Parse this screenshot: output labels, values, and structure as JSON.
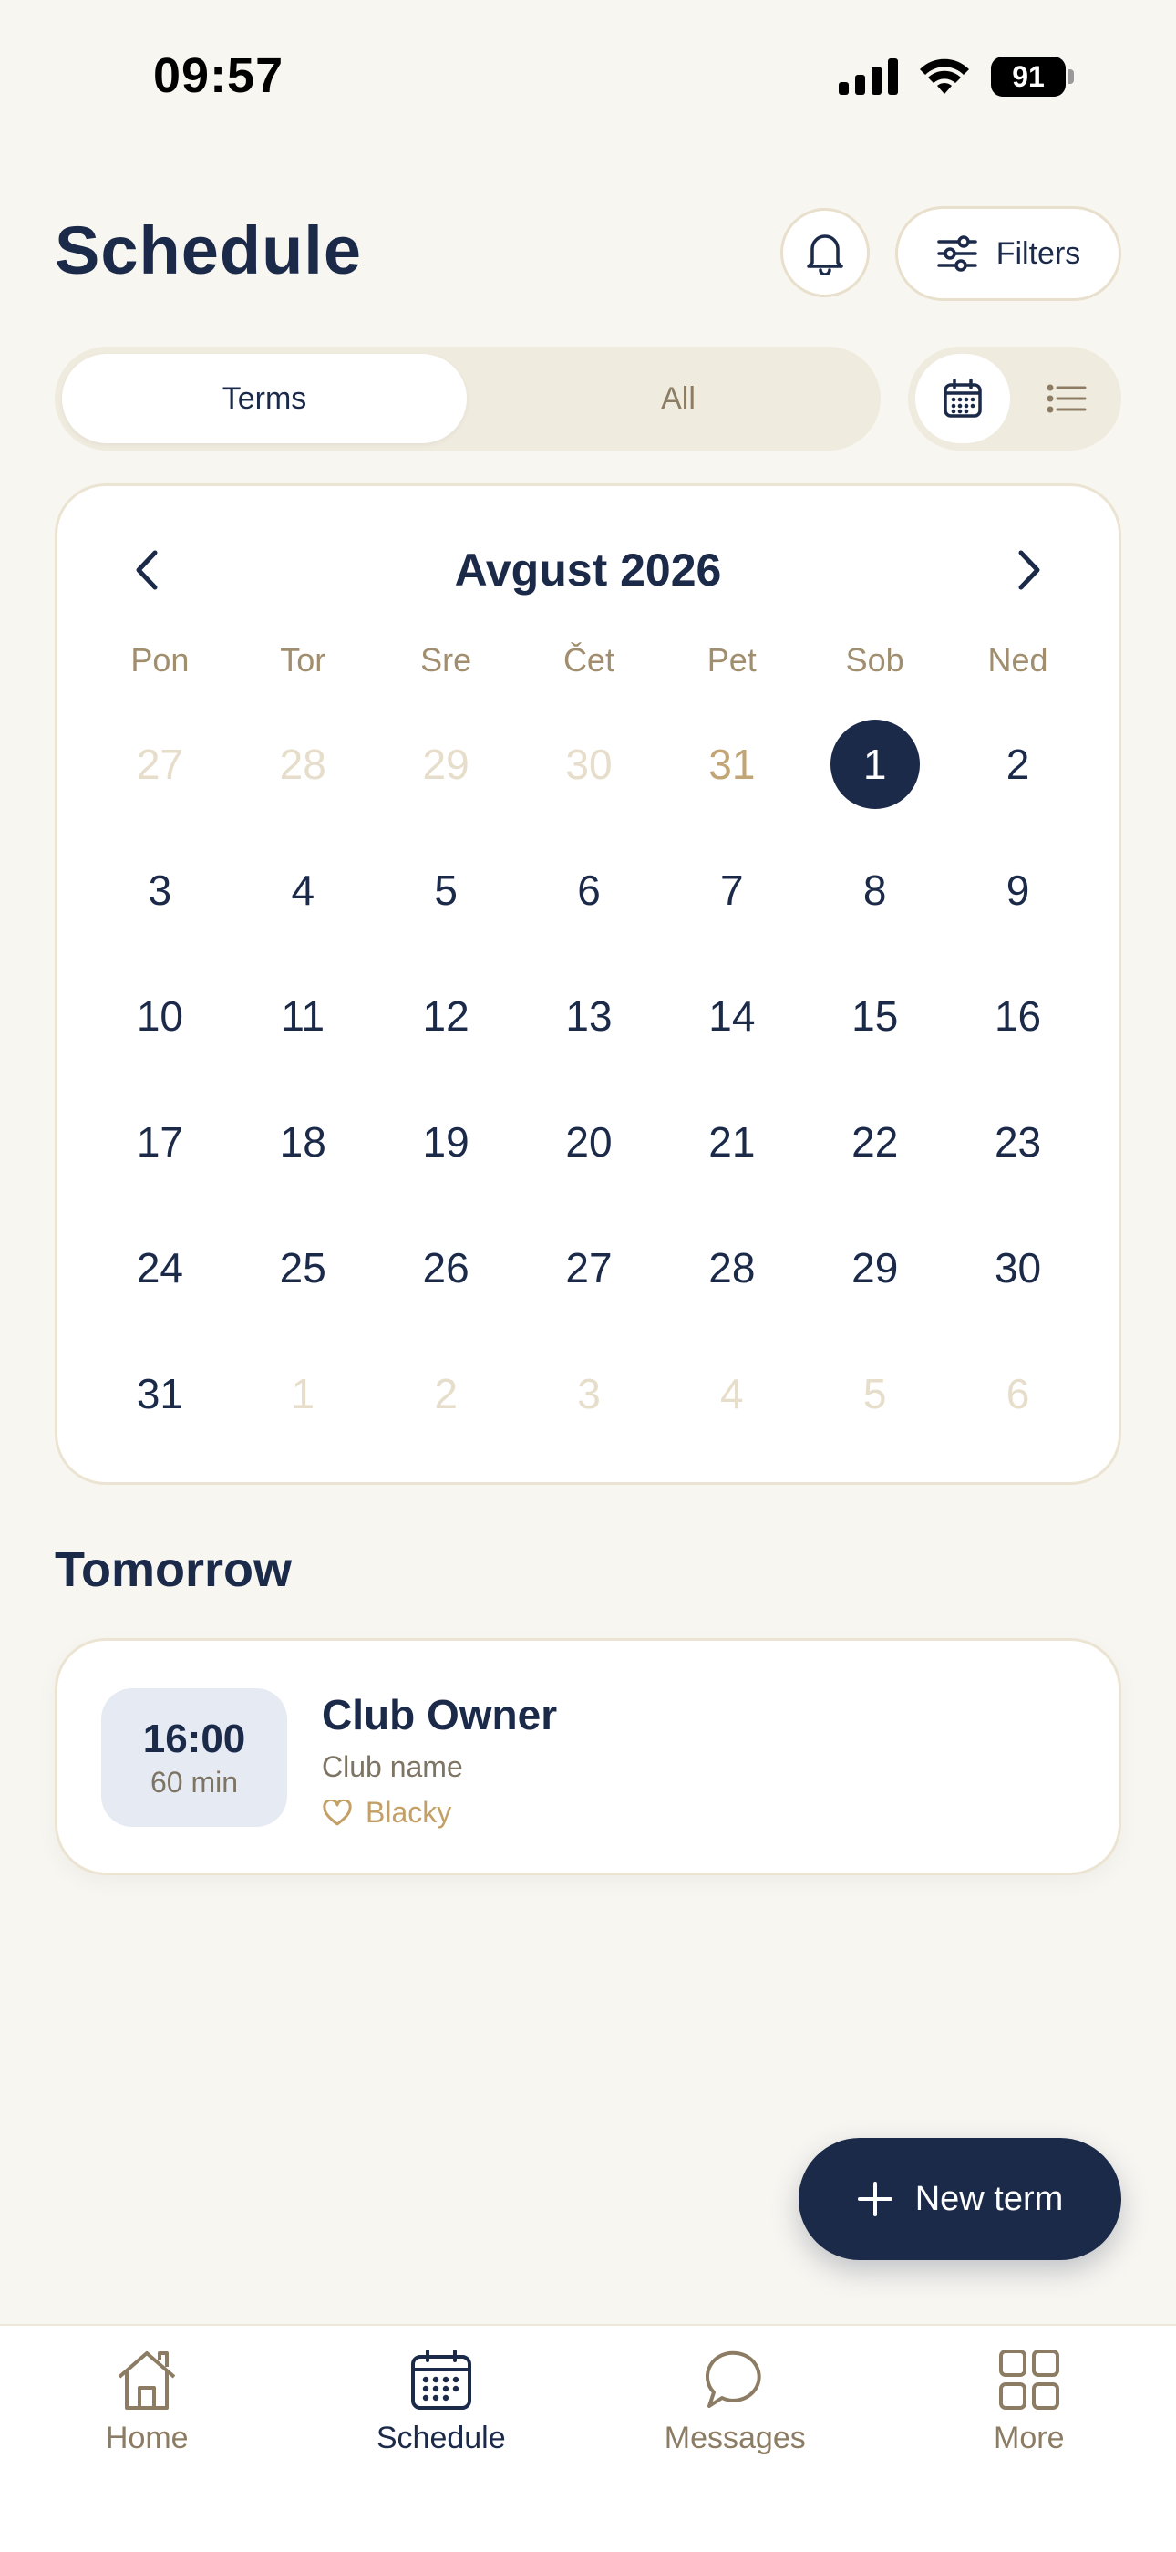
{
  "status_bar": {
    "time": "09:57",
    "battery": "91"
  },
  "header": {
    "title": "Schedule",
    "filters_label": "Filters"
  },
  "segment": {
    "options": [
      "Terms",
      "All"
    ],
    "selected": "Terms"
  },
  "calendar": {
    "month_label": "Avgust 2026",
    "weekdays": [
      "Pon",
      "Tor",
      "Sre",
      "Čet",
      "Pet",
      "Sob",
      "Ned"
    ],
    "days": [
      {
        "n": "27",
        "state": "muted"
      },
      {
        "n": "28",
        "state": "muted"
      },
      {
        "n": "29",
        "state": "muted"
      },
      {
        "n": "30",
        "state": "muted"
      },
      {
        "n": "31",
        "state": "muted-gold"
      },
      {
        "n": "1",
        "state": "selected"
      },
      {
        "n": "2",
        "state": ""
      },
      {
        "n": "3",
        "state": ""
      },
      {
        "n": "4",
        "state": ""
      },
      {
        "n": "5",
        "state": ""
      },
      {
        "n": "6",
        "state": ""
      },
      {
        "n": "7",
        "state": ""
      },
      {
        "n": "8",
        "state": ""
      },
      {
        "n": "9",
        "state": ""
      },
      {
        "n": "10",
        "state": ""
      },
      {
        "n": "11",
        "state": ""
      },
      {
        "n": "12",
        "state": ""
      },
      {
        "n": "13",
        "state": ""
      },
      {
        "n": "14",
        "state": ""
      },
      {
        "n": "15",
        "state": ""
      },
      {
        "n": "16",
        "state": ""
      },
      {
        "n": "17",
        "state": ""
      },
      {
        "n": "18",
        "state": ""
      },
      {
        "n": "19",
        "state": ""
      },
      {
        "n": "20",
        "state": ""
      },
      {
        "n": "21",
        "state": ""
      },
      {
        "n": "22",
        "state": ""
      },
      {
        "n": "23",
        "state": ""
      },
      {
        "n": "24",
        "state": ""
      },
      {
        "n": "25",
        "state": ""
      },
      {
        "n": "26",
        "state": ""
      },
      {
        "n": "27",
        "state": ""
      },
      {
        "n": "28",
        "state": ""
      },
      {
        "n": "29",
        "state": ""
      },
      {
        "n": "30",
        "state": ""
      },
      {
        "n": "31",
        "state": ""
      },
      {
        "n": "1",
        "state": "muted"
      },
      {
        "n": "2",
        "state": "muted"
      },
      {
        "n": "3",
        "state": "muted"
      },
      {
        "n": "4",
        "state": "muted"
      },
      {
        "n": "5",
        "state": "muted"
      },
      {
        "n": "6",
        "state": "muted"
      }
    ]
  },
  "section": {
    "title": "Tomorrow",
    "event": {
      "time": "16:00",
      "duration": "60 min",
      "title": "Club Owner",
      "club": "Club name",
      "favorite": "Blacky"
    }
  },
  "fab": {
    "label": "New term"
  },
  "nav": {
    "items": [
      {
        "label": "Home",
        "icon": "home-icon"
      },
      {
        "label": "Schedule",
        "icon": "calendar-icon"
      },
      {
        "label": "Messages",
        "icon": "chat-icon"
      },
      {
        "label": "More",
        "icon": "grid-icon"
      }
    ],
    "active": "Schedule"
  },
  "colors": {
    "primary": "#1c2a4a",
    "accent_gold": "#c2a066",
    "background": "#f8f6f1",
    "muted_text": "#8c7c63"
  }
}
